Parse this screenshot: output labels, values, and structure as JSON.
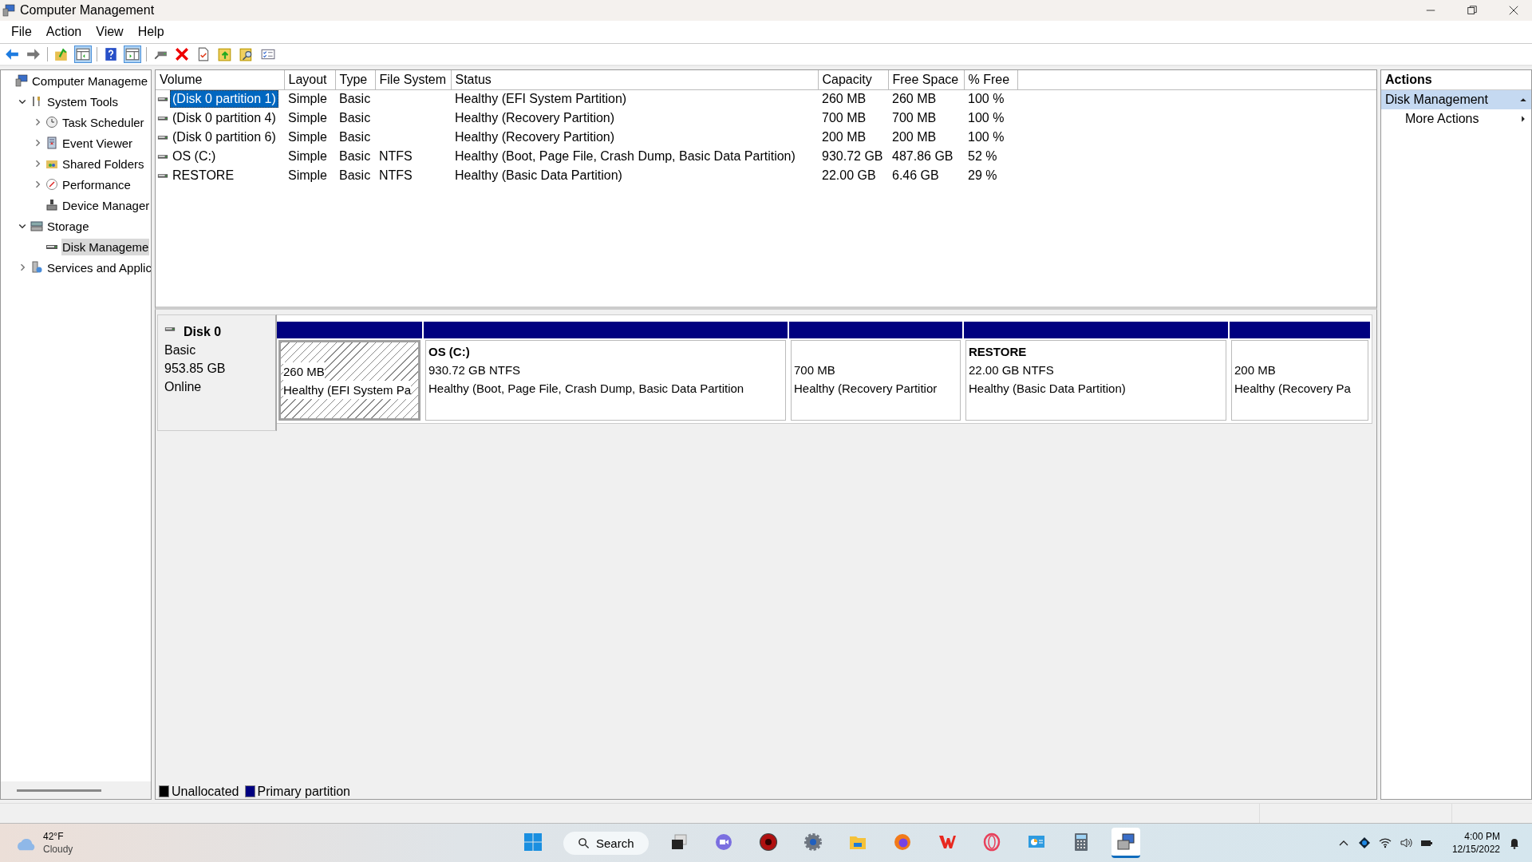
{
  "window": {
    "title": "Computer Management"
  },
  "menu": [
    "File",
    "Action",
    "View",
    "Help"
  ],
  "toolbar": [
    [
      {
        "kind": "back",
        "pressed": false
      },
      {
        "kind": "forward",
        "pressed": false
      }
    ],
    [
      {
        "kind": "up",
        "pressed": false
      },
      {
        "kind": "tree-pane",
        "pressed": true
      }
    ],
    [
      {
        "kind": "help",
        "pressed": false
      },
      {
        "kind": "action-pane",
        "pressed": true
      }
    ],
    [
      {
        "kind": "connect",
        "pressed": false
      },
      {
        "kind": "delete",
        "pressed": false
      },
      {
        "kind": "properties",
        "pressed": false
      },
      {
        "kind": "export",
        "pressed": false
      },
      {
        "kind": "find",
        "pressed": false
      },
      {
        "kind": "list",
        "pressed": false
      }
    ]
  ],
  "tree": [
    {
      "label": "Computer Manageme",
      "kind": "computer",
      "selected": false,
      "children": [
        {
          "label": "System Tools",
          "kind": "tools",
          "expanded": true,
          "selected": false,
          "children": [
            {
              "label": "Task Scheduler",
              "kind": "clock",
              "expanded": false,
              "selected": false
            },
            {
              "label": "Event Viewer",
              "kind": "log",
              "expanded": false,
              "selected": false
            },
            {
              "label": "Shared Folders",
              "kind": "share",
              "expanded": false,
              "selected": false
            },
            {
              "label": "Performance",
              "kind": "gauge",
              "expanded": false,
              "selected": false
            },
            {
              "label": "Device Manager",
              "kind": "device",
              "selected": false
            }
          ]
        },
        {
          "label": "Storage",
          "kind": "storage",
          "expanded": true,
          "selected": false,
          "children": [
            {
              "label": "Disk Manageme",
              "kind": "drive",
              "selected": true
            }
          ]
        },
        {
          "label": "Services and Applic",
          "kind": "services",
          "expanded": false,
          "selected": false
        }
      ]
    }
  ],
  "volumes": {
    "columns": [
      "Volume",
      "Layout",
      "Type",
      "File System",
      "Status",
      "Capacity",
      "Free Space",
      "% Free"
    ],
    "rows": [
      {
        "selected": true,
        "cells": [
          "(Disk 0 partition 1)",
          "Simple",
          "Basic",
          "",
          "Healthy (EFI System Partition)",
          "260 MB",
          "260 MB",
          "100 %"
        ]
      },
      {
        "selected": false,
        "cells": [
          "(Disk 0 partition 4)",
          "Simple",
          "Basic",
          "",
          "Healthy (Recovery Partition)",
          "700 MB",
          "700 MB",
          "100 %"
        ]
      },
      {
        "selected": false,
        "cells": [
          "(Disk 0 partition 6)",
          "Simple",
          "Basic",
          "",
          "Healthy (Recovery Partition)",
          "200 MB",
          "200 MB",
          "100 %"
        ]
      },
      {
        "selected": false,
        "cells": [
          "OS (C:)",
          "Simple",
          "Basic",
          "NTFS",
          "Healthy (Boot, Page File, Crash Dump, Basic Data Partition)",
          "930.72 GB",
          "487.86 GB",
          "52 %"
        ]
      },
      {
        "selected": false,
        "cells": [
          "RESTORE",
          "Simple",
          "Basic",
          "NTFS",
          "Healthy (Basic Data Partition)",
          "22.00 GB",
          "6.46 GB",
          "29 %"
        ]
      }
    ]
  },
  "disk": {
    "name": "Disk 0",
    "type": "Basic",
    "size": "953.85 GB",
    "status": "Online",
    "partitions": [
      {
        "selected": true,
        "color": "#000080",
        "size": "260 MB",
        "status": "Healthy (EFI System Pa"
      },
      {
        "selected": false,
        "color": "#000080",
        "label": "OS  (C:)",
        "size": "930.72 GB NTFS",
        "status": "Healthy (Boot, Page File, Crash Dump, Basic Data Partition"
      },
      {
        "selected": false,
        "color": "#000080",
        "size": "700 MB",
        "status": "Healthy (Recovery Partitior"
      },
      {
        "selected": false,
        "color": "#000080",
        "label": "RESTORE",
        "size": "22.00 GB NTFS",
        "status": "Healthy (Basic Data Partition)"
      },
      {
        "selected": false,
        "color": "#000080",
        "size": "200 MB",
        "status": "Healthy (Recovery Pa"
      }
    ]
  },
  "legend": [
    {
      "label": "Unallocated",
      "color": "#000000"
    },
    {
      "label": "Primary partition",
      "color": "#000080"
    }
  ],
  "actions": {
    "title": "Actions",
    "items": [
      {
        "label": "Disk Management",
        "kind": "section"
      },
      {
        "label": "More Actions",
        "kind": "submenu"
      }
    ]
  },
  "taskbar": {
    "weather": {
      "temperature": "42°F",
      "condition": "Cloudy"
    },
    "search": "Search",
    "apps": [
      {
        "kind": "start",
        "active": false
      },
      {
        "kind": "task-view",
        "active": false
      },
      {
        "kind": "video",
        "active": false
      },
      {
        "kind": "red-disc",
        "active": false
      },
      {
        "kind": "settings",
        "active": false
      },
      {
        "kind": "folder",
        "active": false
      },
      {
        "kind": "fox",
        "active": false
      },
      {
        "kind": "red-w",
        "active": false
      },
      {
        "kind": "ring",
        "active": false
      },
      {
        "kind": "chart",
        "active": false
      },
      {
        "kind": "calculator",
        "active": false
      },
      {
        "kind": "computer",
        "active": true
      }
    ],
    "tray": [
      {
        "kind": "chevron"
      },
      {
        "kind": "diamond"
      },
      {
        "kind": "wifi"
      },
      {
        "kind": "volume"
      },
      {
        "kind": "battery"
      }
    ],
    "time": "4:00 PM",
    "date": "12/15/2022"
  }
}
